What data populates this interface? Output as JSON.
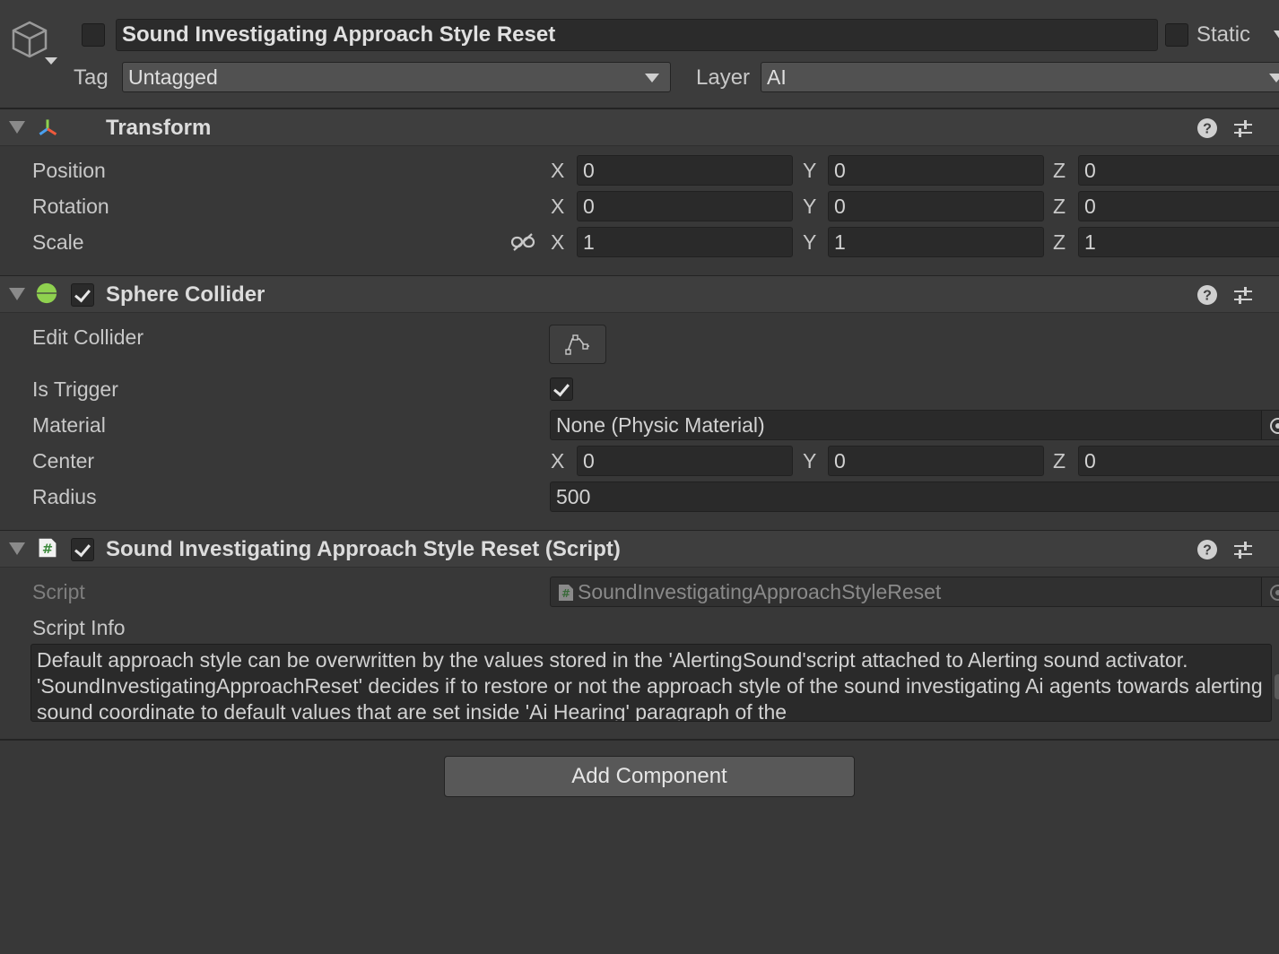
{
  "object": {
    "active": false,
    "name": "Sound Investigating Approach Style Reset",
    "static_label": "Static",
    "static": false,
    "tag_label": "Tag",
    "tag_value": "Untagged",
    "layer_label": "Layer",
    "layer_value": "AI"
  },
  "transform": {
    "title": "Transform",
    "rows": [
      {
        "label": "Position",
        "x": "0",
        "y": "0",
        "z": "0"
      },
      {
        "label": "Rotation",
        "x": "0",
        "y": "0",
        "z": "0"
      },
      {
        "label": "Scale",
        "x": "1",
        "y": "1",
        "z": "1"
      }
    ],
    "axis_x": "X",
    "axis_y": "Y",
    "axis_z": "Z"
  },
  "sphere_collider": {
    "title": "Sphere Collider",
    "enabled": true,
    "edit_collider_label": "Edit Collider",
    "is_trigger_label": "Is Trigger",
    "is_trigger": true,
    "material_label": "Material",
    "material_value": "None (Physic Material)",
    "center_label": "Center",
    "center": {
      "x": "0",
      "y": "0",
      "z": "0"
    },
    "radius_label": "Radius",
    "radius_value": "500"
  },
  "script_component": {
    "title": "Sound Investigating Approach Style Reset (Script)",
    "enabled": true,
    "script_label": "Script",
    "script_value": "SoundInvestigatingApproachStyleReset",
    "script_info_label": "Script Info",
    "script_info_text": "Default approach style can be overwritten by the values stored in the 'AlertingSound'script attached to Alerting sound activator. 'SoundInvestigatingApproachReset'  decides if to restore or not the approach style of the sound investigating Ai agents towards alerting sound coordinate to default values that are set inside 'Ai Hearing' paragraph of the"
  },
  "footer": {
    "add_component_label": "Add Component"
  },
  "colors": {
    "background": "#383838",
    "field": "#2a2a2a",
    "header": "#3e3e3e",
    "collider_green": "#8fd14f"
  }
}
